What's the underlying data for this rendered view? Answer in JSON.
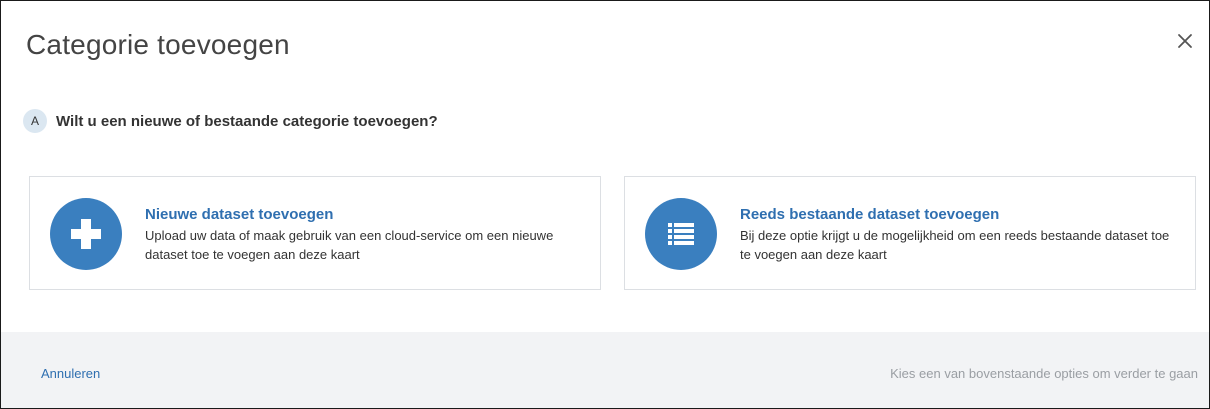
{
  "modal": {
    "title": "Categorie toevoegen",
    "close_icon": "close-icon"
  },
  "step": {
    "badge": "A",
    "question": "Wilt u een nieuwe of bestaande categorie toevoegen?"
  },
  "options": [
    {
      "icon": "plus-icon",
      "title": "Nieuwe dataset toevoegen",
      "description": "Upload uw data of maak gebruik van een cloud-service om een nieuwe dataset toe te voegen aan deze kaart"
    },
    {
      "icon": "list-icon",
      "title": "Reeds bestaande dataset toevoegen",
      "description": "Bij deze optie krijgt u de mogelijkheid om een reeds bestaande dataset toe te voegen aan deze kaart"
    }
  ],
  "footer": {
    "cancel_label": "Annuleren",
    "hint": "Kies een van bovenstaande opties om verder te gaan"
  },
  "colors": {
    "accent": "#3a7fbf",
    "link": "#2f6fb0",
    "footer_bg": "#f2f3f5",
    "badge_bg": "#dbe7f1"
  }
}
